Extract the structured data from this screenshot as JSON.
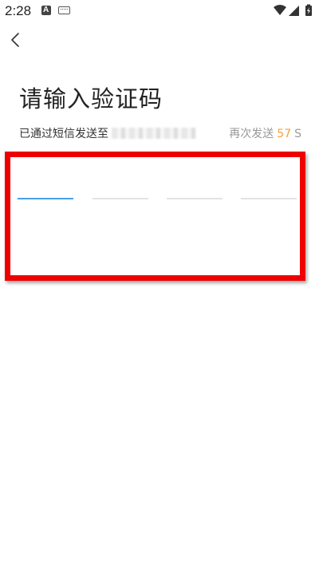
{
  "status_bar": {
    "time": "2:28",
    "notification_icons": [
      "a-notification-icon",
      "keyboard-icon"
    ],
    "system_icons": [
      "wifi-icon",
      "signal-icon",
      "battery-charging-icon"
    ]
  },
  "nav": {
    "back_icon": "chevron-left-icon"
  },
  "title": "请输入验证码",
  "sent_info": "已通过短信发送至",
  "resend": {
    "label": "再次发送",
    "countdown": "57",
    "unit": "S"
  },
  "code_input": {
    "length": 4,
    "digits": [
      "",
      "",
      "",
      ""
    ],
    "active_index": 0
  },
  "colors": {
    "accent": "#4a9fe8",
    "countdown": "#f5a23a",
    "highlight": "#ee0000",
    "muted_text": "#999999"
  }
}
